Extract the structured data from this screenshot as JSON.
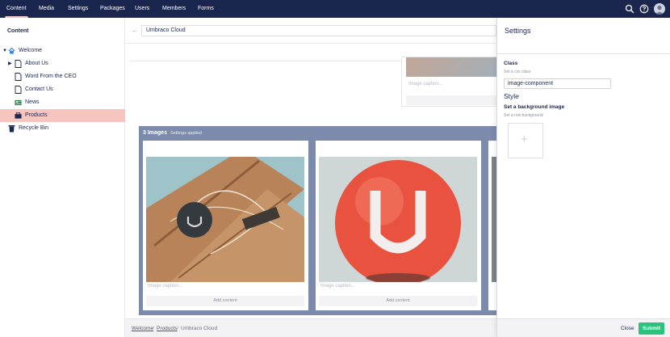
{
  "topnav": {
    "items": [
      {
        "label": "Content",
        "active": true
      },
      {
        "label": "Media"
      },
      {
        "label": "Settings"
      },
      {
        "label": "Packages"
      },
      {
        "label": "Users"
      },
      {
        "label": "Members"
      },
      {
        "label": "Forms"
      }
    ],
    "icons": [
      "search-icon",
      "help-icon",
      "avatar"
    ]
  },
  "tree": {
    "header": "Content",
    "nodes": [
      {
        "label": "Welcome",
        "icon": "home-icon"
      },
      {
        "label": "About Us",
        "icon": "document-icon",
        "expandable": true
      },
      {
        "label": "Word From the CEO",
        "icon": "document-icon"
      },
      {
        "label": "Contact Us",
        "icon": "document-icon"
      },
      {
        "label": "News",
        "icon": "news-icon"
      },
      {
        "label": "Products",
        "icon": "products-icon",
        "selected": true
      },
      {
        "label": "Recycle Bin",
        "icon": "trash-icon"
      }
    ]
  },
  "editor": {
    "name_value": "Umbraco Cloud",
    "prev_caption": "Image caption...",
    "row": {
      "title": "3 Images",
      "settings_text": "Settings applied",
      "cells": [
        {
          "caption": "Image caption...",
          "add_label": "Add content"
        },
        {
          "caption": "Image caption...",
          "add_label": "Add content"
        }
      ]
    }
  },
  "breadcrumb": [
    "Welcome",
    "Products",
    "Umbraco Cloud"
  ],
  "settings_panel": {
    "title": "Settings",
    "class_label": "Class",
    "class_desc": "Set a css class",
    "class_value": "image-component",
    "style_heading": "Style",
    "bg_label": "Set a background image",
    "bg_desc": "Set a row background",
    "close_label": "Close",
    "submit_label": "Submit"
  },
  "colors": {
    "nav_bg": "#1b264f",
    "selected_tree": "#f6c5c0",
    "row_bg": "#7c8bab",
    "submit": "#2bc37c"
  }
}
